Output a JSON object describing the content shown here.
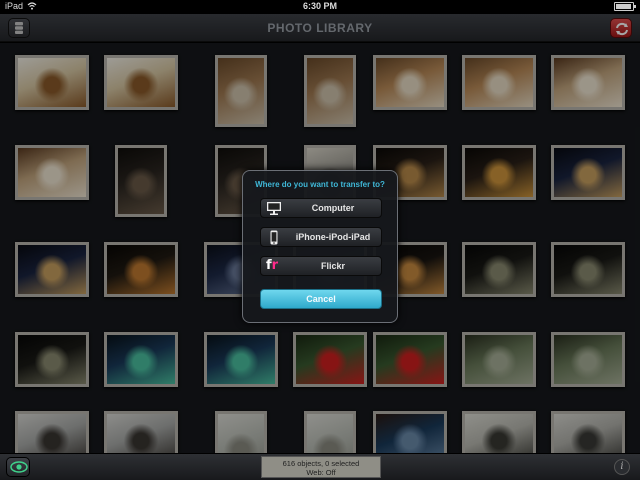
{
  "statusbar": {
    "device": "iPad",
    "time": "6:30 PM"
  },
  "navbar": {
    "title": "PHOTO LIBRARY"
  },
  "dialog": {
    "prompt": "Where do you want to transfer to?",
    "options": [
      {
        "label": "Computer",
        "icon": "monitor-icon"
      },
      {
        "label": "iPhone-iPod-iPad",
        "icon": "iphone-icon"
      },
      {
        "label": "Flickr",
        "icon": "flickr-icon"
      }
    ],
    "cancel": "Cancel"
  },
  "bottombar": {
    "status_line1": "616 objects, 0 selected",
    "status_line2": "Web: Off",
    "info": "i"
  },
  "colors": {
    "accent": "#3fb7d7",
    "close_red": "#d23030",
    "frame": "#b9b6ae",
    "background": "#16181c"
  },
  "photos": [
    {
      "subject": "food-plate",
      "colors": [
        "#d8c8a4",
        "#8a5a2a",
        "#f2efe6"
      ]
    },
    {
      "subject": "food-plate",
      "colors": [
        "#d8c8a4",
        "#8a5a2a",
        "#f2efe6"
      ]
    },
    {
      "subject": "water-glass",
      "colors": [
        "#a07a52",
        "#cfc3ad",
        "#6a4a2a"
      ]
    },
    {
      "subject": "water-glass",
      "colors": [
        "#a07a52",
        "#cfc3ad",
        "#6a4a2a"
      ]
    },
    {
      "subject": "glass-table",
      "colors": [
        "#b98a58",
        "#e8dcc5",
        "#6a4a2a"
      ]
    },
    {
      "subject": "glass-table",
      "colors": [
        "#b98a58",
        "#e8dcc5",
        "#6a4a2a"
      ]
    },
    {
      "subject": "chopsticks",
      "colors": [
        "#c2a57e",
        "#efe5d2",
        "#5a3a20"
      ]
    },
    {
      "subject": "chopsticks",
      "colors": [
        "#c2a57e",
        "#efe5d2",
        "#5a3a20"
      ]
    },
    {
      "subject": "restaurant-interior",
      "colors": [
        "#2a2520",
        "#6a5a48",
        "#0f0d0a"
      ]
    },
    {
      "subject": "restaurant-interior",
      "colors": [
        "#2a2520",
        "#6a5a48",
        "#0f0d0a"
      ]
    },
    {
      "subject": "building",
      "colors": [
        "#9a9890",
        "#5a5550",
        "#d8d4c8"
      ]
    },
    {
      "subject": "night-street",
      "colors": [
        "#2a2018",
        "#b88a4a",
        "#0a0806"
      ]
    },
    {
      "subject": "night-street",
      "colors": [
        "#2a2018",
        "#d0963c",
        "#0a0806"
      ]
    },
    {
      "subject": "night-city",
      "colors": [
        "#1a2440",
        "#c8a060",
        "#080a12"
      ]
    },
    {
      "subject": "night-city",
      "colors": [
        "#1a2440",
        "#c8a060",
        "#080a12"
      ]
    },
    {
      "subject": "night-street",
      "colors": [
        "#201a12",
        "#c07a30",
        "#080604"
      ]
    },
    {
      "subject": "station-plaza",
      "colors": [
        "#1e2a48",
        "#6a7a9a",
        "#0a0e18"
      ]
    },
    {
      "subject": "station-plaza",
      "colors": [
        "#1e2a48",
        "#6a7a9a",
        "#0a0e18"
      ]
    },
    {
      "subject": "night-lot",
      "colors": [
        "#181410",
        "#c88a40",
        "#060504"
      ]
    },
    {
      "subject": "bike-parking",
      "colors": [
        "#1a1a16",
        "#8a8a70",
        "#060606"
      ]
    },
    {
      "subject": "bike-parking",
      "colors": [
        "#1a1a16",
        "#8a8a70",
        "#060606"
      ]
    },
    {
      "subject": "bike-parking",
      "colors": [
        "#1a1a16",
        "#8a8a70",
        "#060606"
      ]
    },
    {
      "subject": "lit-building",
      "colors": [
        "#1a3a5a",
        "#4ac0a0",
        "#08121a"
      ]
    },
    {
      "subject": "lit-building",
      "colors": [
        "#1a3a5a",
        "#4ac0a0",
        "#08121a"
      ]
    },
    {
      "subject": "red-camellia",
      "colors": [
        "#3a5a30",
        "#d02020",
        "#1a2a14"
      ]
    },
    {
      "subject": "red-camellia",
      "colors": [
        "#3a5a30",
        "#d02020",
        "#1a2a14"
      ]
    },
    {
      "subject": "planter",
      "colors": [
        "#6a7a5a",
        "#a8b098",
        "#2a3020"
      ]
    },
    {
      "subject": "planter",
      "colors": [
        "#6a7a5a",
        "#a8b098",
        "#2a3020"
      ]
    },
    {
      "subject": "bare-tree",
      "colors": [
        "#a8aaa8",
        "#3a3632",
        "#d8d8d4"
      ]
    },
    {
      "subject": "bare-tree",
      "colors": [
        "#a8aaa8",
        "#3a3632",
        "#d8d8d4"
      ]
    },
    {
      "subject": "pale-sky",
      "colors": [
        "#b8bcb4",
        "#8a8a80",
        "#dcdcd6"
      ]
    },
    {
      "subject": "pale-sky",
      "colors": [
        "#b8bcb4",
        "#8a8a80",
        "#dcdcd6"
      ]
    },
    {
      "subject": "shrine-gate",
      "colors": [
        "#1a3a5a",
        "#6a8aaa",
        "#2a1a14"
      ]
    },
    {
      "subject": "temple",
      "colors": [
        "#b8b8b0",
        "#3a3a34",
        "#dcdcd4"
      ]
    },
    {
      "subject": "bare-branches",
      "colors": [
        "#b0b0aa",
        "#3a3a36",
        "#d8d8d2"
      ]
    },
    {
      "subject": "bare-branches",
      "colors": [
        "#b0b0aa",
        "#3a3a36",
        "#d8d8d2"
      ]
    }
  ]
}
